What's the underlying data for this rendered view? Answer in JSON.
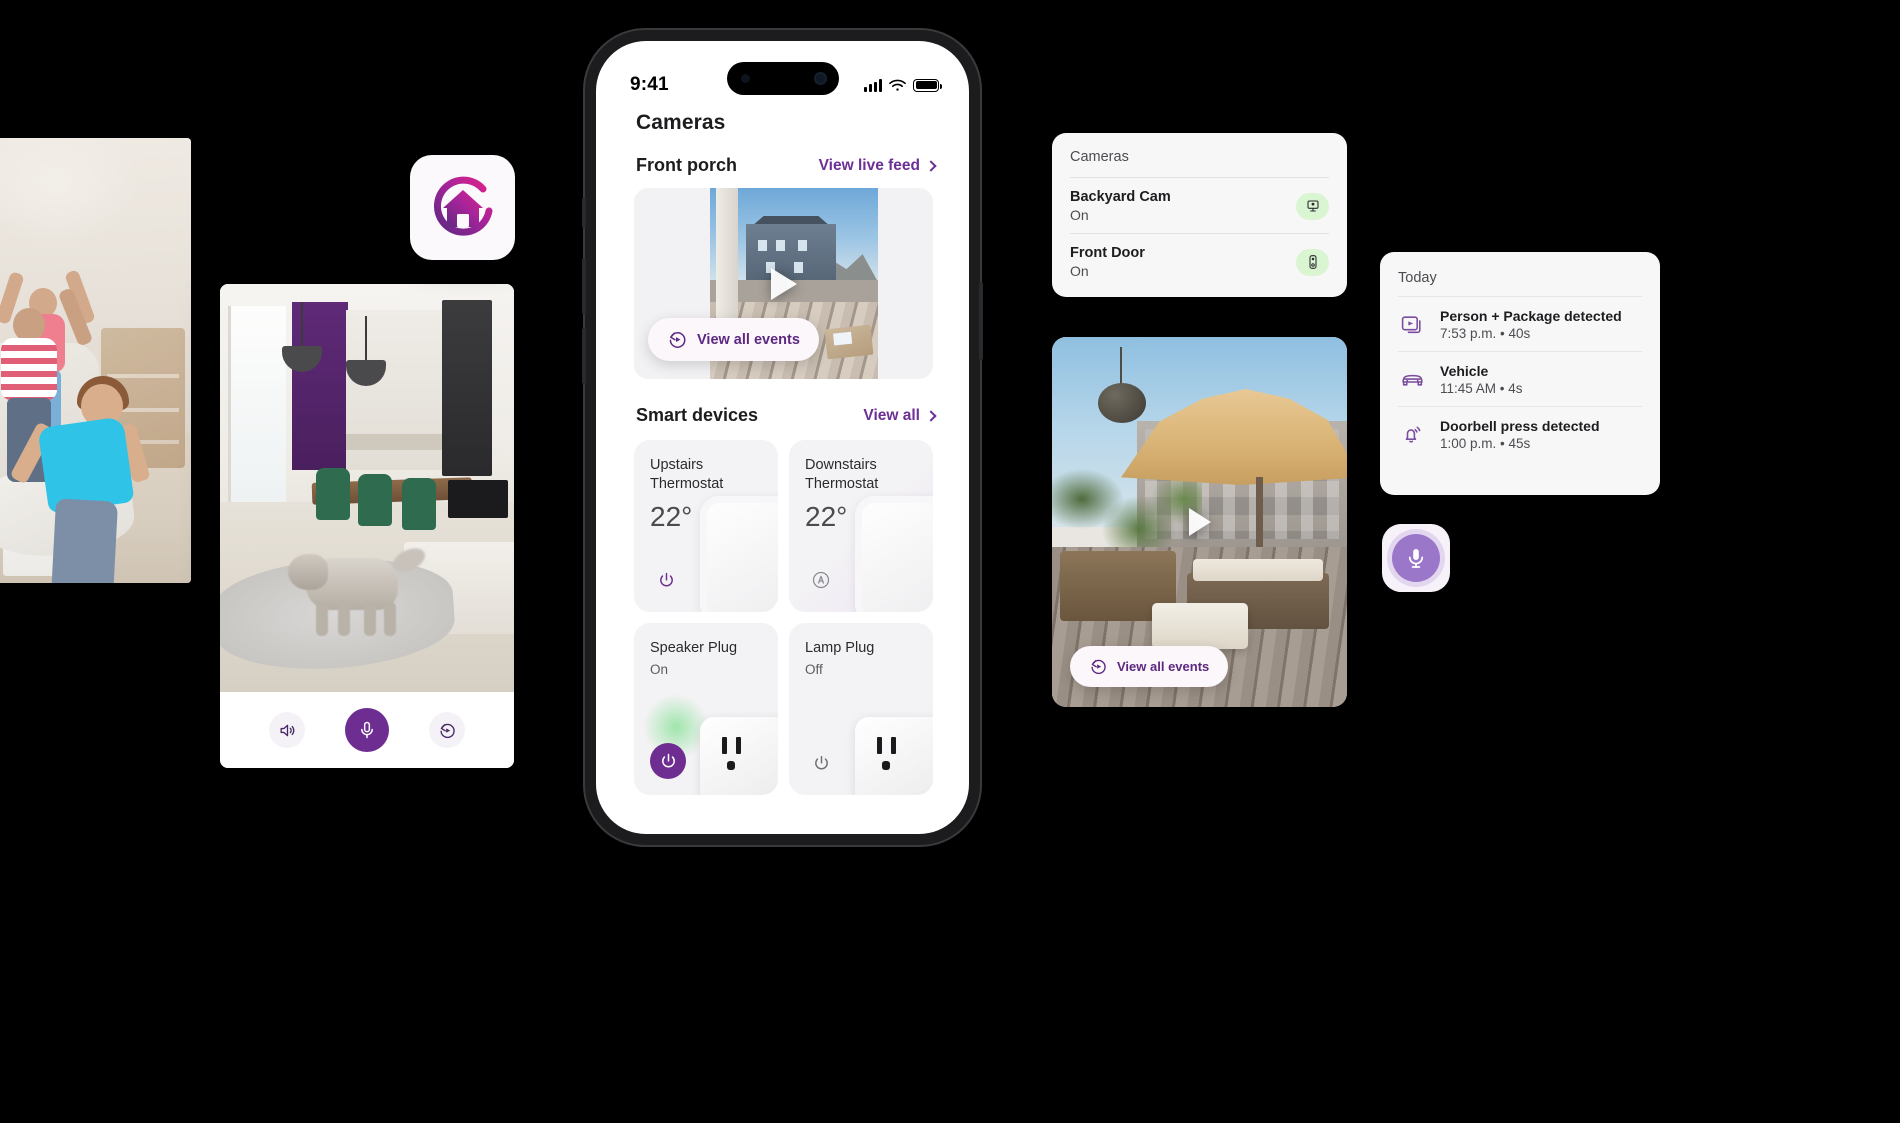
{
  "phone": {
    "status_bar": {
      "time": "9:41",
      "signal_icon": "cellular-bars-icon",
      "wifi_icon": "wifi-icon",
      "battery_icon": "battery-icon"
    },
    "screen_title": "Cameras",
    "camera_section": {
      "name": "Front porch",
      "link_label": "View live feed",
      "events_pill_label": "View all events",
      "play_icon": "play-icon"
    },
    "devices_section": {
      "title": "Smart devices",
      "link_label": "View all",
      "cards": [
        {
          "name": "Upstairs Thermostat",
          "value": "22°",
          "button_icon": "power-icon",
          "state": ""
        },
        {
          "name": "Downstairs Thermostat",
          "value": "22°",
          "button_icon": "auto-icon",
          "state": ""
        },
        {
          "name": "Speaker Plug",
          "value": "",
          "state": "On",
          "button_icon": "power-icon"
        },
        {
          "name": "Lamp Plug",
          "value": "",
          "state": "Off",
          "button_icon": "power-icon"
        }
      ]
    }
  },
  "left_camera_card": {
    "controls": [
      {
        "icon": "speaker-icon",
        "name": "speaker-button"
      },
      {
        "icon": "microphone-icon",
        "name": "talk-button"
      },
      {
        "icon": "rewind-events-icon",
        "name": "history-button"
      }
    ]
  },
  "app_icon": {
    "name": "home-plus-app-icon",
    "gradient_from": "#e0218a",
    "gradient_to": "#5c2880"
  },
  "cameras_widget": {
    "title": "Cameras",
    "rows": [
      {
        "name": "Backyard Cam",
        "state": "On",
        "icon": "security-camera-icon",
        "badge_color": "#d9f5d2"
      },
      {
        "name": "Front Door",
        "state": "On",
        "icon": "doorbell-icon",
        "badge_color": "#d9f5d2"
      }
    ]
  },
  "patio_card": {
    "events_pill_label": "View all events",
    "play_icon": "play-icon"
  },
  "events_widget": {
    "title": "Today",
    "items": [
      {
        "icon": "video-clip-icon",
        "title": "Person + Package detected",
        "meta": "7:53 p.m. • 40s"
      },
      {
        "icon": "vehicle-icon",
        "title": "Vehicle",
        "meta": "11:45 AM • 4s"
      },
      {
        "icon": "doorbell-ring-icon",
        "title": "Doorbell press detected",
        "meta": "1:00 p.m. • 45s"
      }
    ]
  },
  "floating_mic": {
    "icon": "microphone-icon",
    "color": "#9b77c9"
  },
  "theme": {
    "accent_purple": "#6d2d91",
    "link_purple": "#6b2f96",
    "badge_green": "#d9f5d2",
    "card_grey": "#f3f2f4"
  }
}
